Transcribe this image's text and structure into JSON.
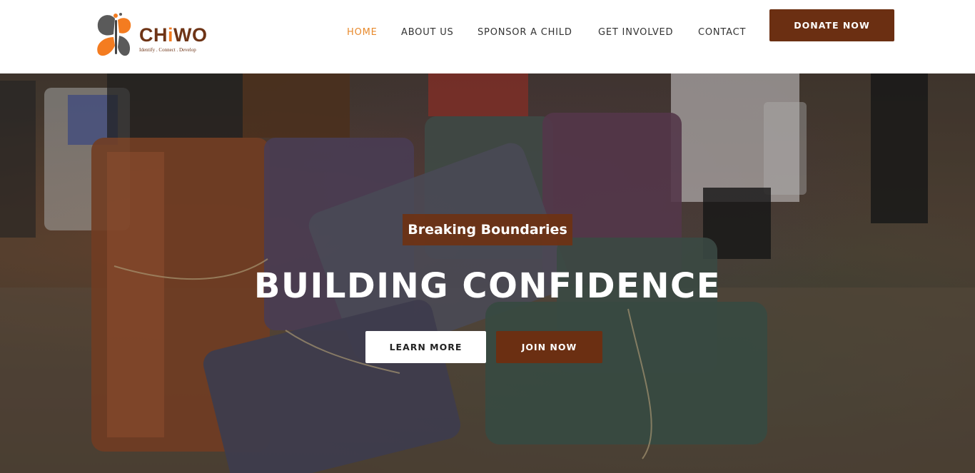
{
  "brand": {
    "name_part1": "CH",
    "name_accent": "i",
    "name_part2": "WO",
    "tagline": "Identify . Connect . Develop",
    "colors": {
      "primary": "#6b2f12",
      "accent": "#f47c20",
      "nav_active": "#e88a2d"
    }
  },
  "nav": {
    "items": [
      {
        "label": "HOME",
        "active": true
      },
      {
        "label": "ABOUT US",
        "active": false
      },
      {
        "label": "SPONSOR A CHILD",
        "active": false
      },
      {
        "label": "GET INVOLVED",
        "active": false
      },
      {
        "label": "CONTACT",
        "active": false
      }
    ],
    "donate_label": "DONATE NOW"
  },
  "hero": {
    "subtitle": "Breaking Boundaries",
    "title": "BUILDING CONFIDENCE",
    "learn_more_label": "LEARN MORE",
    "join_now_label": "JOIN NOW"
  }
}
